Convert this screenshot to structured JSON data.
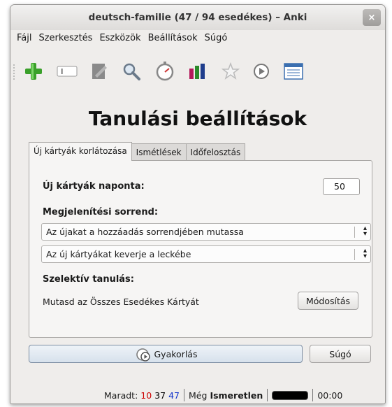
{
  "window": {
    "title": "deutsch-familie (47 / 94 esedékes) – Anki",
    "close_icon": "×"
  },
  "menu": [
    {
      "label": "Fájl",
      "underline": "F"
    },
    {
      "label": "Szerkesztés",
      "underline": "S"
    },
    {
      "label": "Eszközök",
      "underline": "E"
    },
    {
      "label": "Beállítások",
      "underline": "B"
    },
    {
      "label": "Súgó",
      "underline": "S"
    }
  ],
  "toolbar": {
    "icons": [
      "add-card-icon",
      "edit-field-icon",
      "notes-icon",
      "search-icon",
      "timer-icon",
      "statistics-icon",
      "star-icon",
      "play-icon",
      "browser-icon"
    ]
  },
  "heading": "Tanulási beállítások",
  "tabs": [
    "Új kártyák korlátozása",
    "Ismétlések",
    "Időfelosztás"
  ],
  "new_cards": {
    "per_day_label": "Új kártyák naponta:",
    "per_day_value": "50",
    "order_label": "Megjelenítési sorrend:",
    "order_option": "Az újakat a hozzáadás sorrendjében mutassa",
    "mix_option": "Az új kártyákat keverje a leckébe",
    "selective_label": "Szelektív tanulás:",
    "selective_text": "Mutasd az Összes Esedékes Kártyát",
    "modify_button": "Módosítás"
  },
  "buttons": {
    "review": "Gyakorlás",
    "help": "Súgó"
  },
  "status": {
    "remaining_label": "Maradt:",
    "count_red": "10",
    "count_black": "37",
    "count_blue": "47",
    "still_label": "Még",
    "still_value": "Ismeretlen",
    "timer": "00:00"
  },
  "colors": {
    "red": "#cc0000",
    "blue": "#1133cc",
    "accent": "#d7e1ec"
  }
}
